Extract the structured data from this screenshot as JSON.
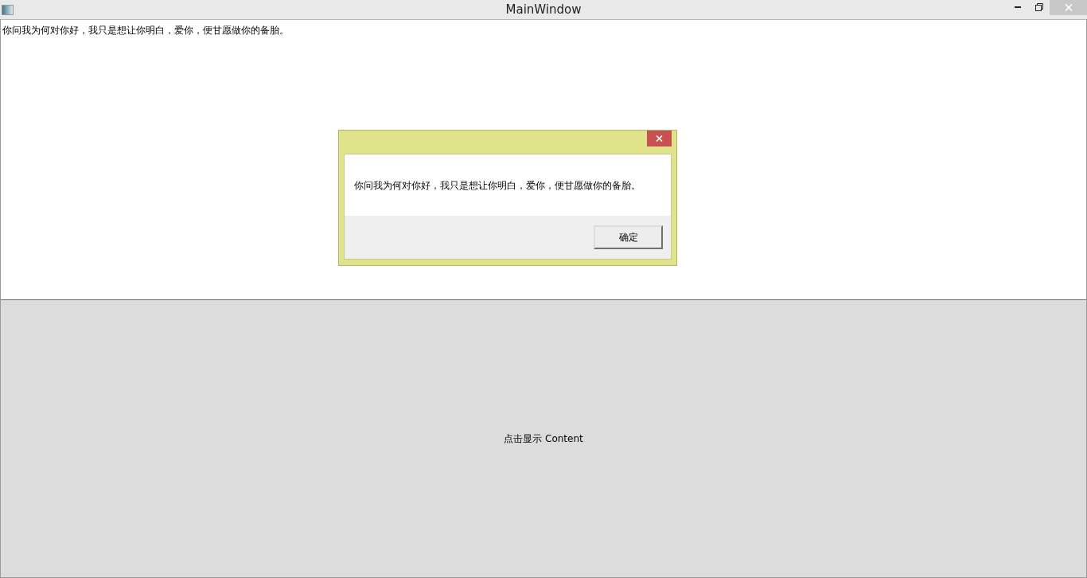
{
  "window": {
    "title": "MainWindow"
  },
  "content_text": "你问我为何对你好，我只是想让你明白，爱你，便甘愿做你的备胎。",
  "dialog": {
    "message": "你问我为何对你好，我只是想让你明白，爱你，便甘愿做你的备胎。",
    "ok_button": "确定"
  },
  "show_button": "点击显示 Content"
}
